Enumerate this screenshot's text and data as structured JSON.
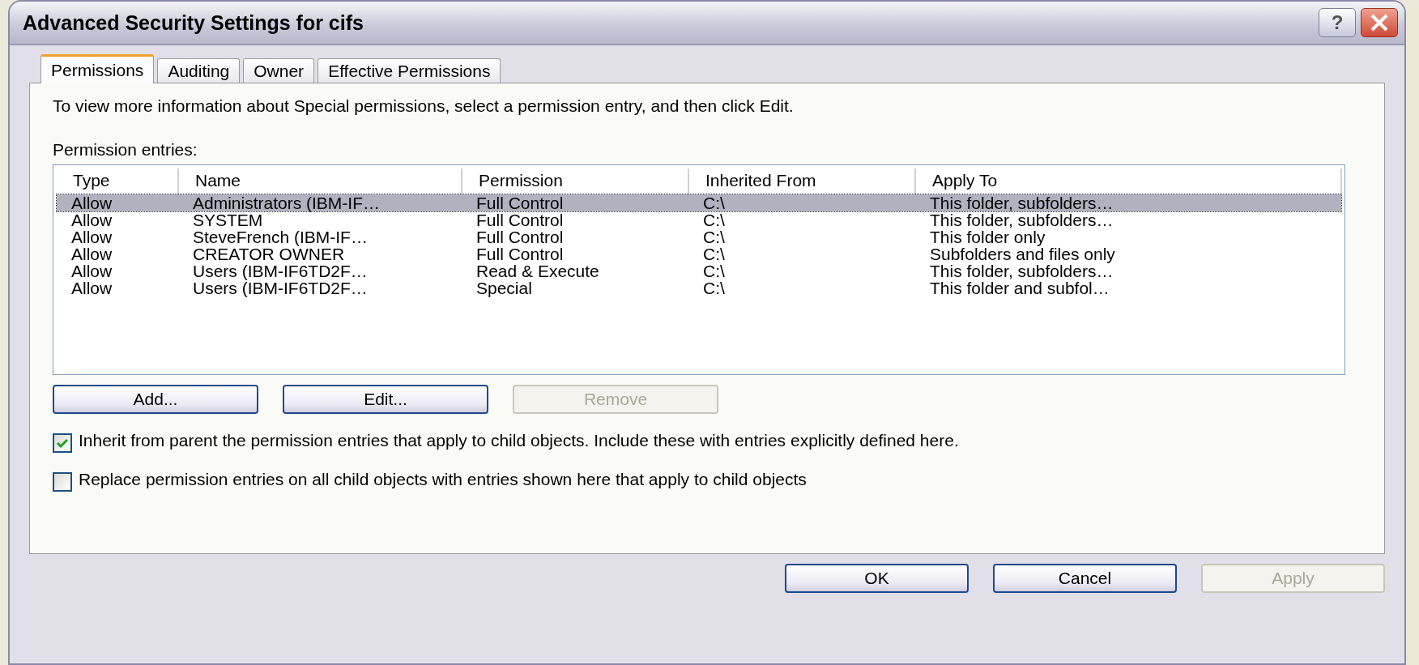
{
  "window": {
    "title": "Advanced Security Settings for cifs",
    "help": "?"
  },
  "tabs": [
    {
      "label": "Permissions",
      "selected": true
    },
    {
      "label": "Auditing",
      "selected": false
    },
    {
      "label": "Owner",
      "selected": false
    },
    {
      "label": "Effective Permissions",
      "selected": false
    }
  ],
  "description": "To view more information about Special permissions, select a permission entry, and then click Edit.",
  "list_label": "Permission entries:",
  "table": {
    "columns": [
      "Type",
      "Name",
      "Permission",
      "Inherited From",
      "Apply To"
    ],
    "rows": [
      {
        "cells": [
          "Allow",
          "Administrators (IBM-IF…",
          "Full Control",
          "C:\\",
          "This folder, subfolders…"
        ],
        "selected": true
      },
      {
        "cells": [
          "Allow",
          "SYSTEM",
          "Full Control",
          "C:\\",
          "This folder, subfolders…"
        ],
        "selected": false
      },
      {
        "cells": [
          "Allow",
          "SteveFrench (IBM-IF…",
          "Full Control",
          "C:\\",
          "This folder only"
        ],
        "selected": false
      },
      {
        "cells": [
          "Allow",
          "CREATOR OWNER",
          "Full Control",
          "C:\\",
          "Subfolders and files only"
        ],
        "selected": false
      },
      {
        "cells": [
          "Allow",
          "Users (IBM-IF6TD2F…",
          "Read & Execute",
          "C:\\",
          "This folder, subfolders…"
        ],
        "selected": false
      },
      {
        "cells": [
          "Allow",
          "Users (IBM-IF6TD2F…",
          "Special",
          "C:\\",
          "This folder and subfol…"
        ],
        "selected": false
      }
    ]
  },
  "list_buttons": [
    {
      "label": "Add...",
      "disabled": false
    },
    {
      "label": "Edit...",
      "disabled": false
    },
    {
      "label": "Remove",
      "disabled": true
    }
  ],
  "options": [
    {
      "label": "Inherit from parent the permission entries that apply to child objects. Include these with entries explicitly defined here.",
      "checked": true
    },
    {
      "label": "Replace permission entries on all child objects with entries shown here that apply to child objects",
      "checked": false
    }
  ],
  "dialog_buttons": [
    {
      "label": "OK",
      "disabled": false
    },
    {
      "label": "Cancel",
      "disabled": false
    },
    {
      "label": "Apply",
      "disabled": true
    }
  ]
}
